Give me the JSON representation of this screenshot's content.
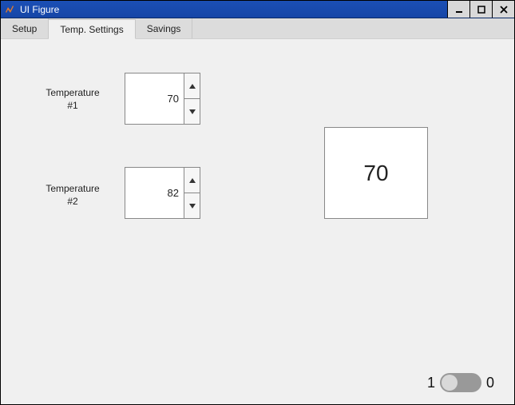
{
  "window": {
    "title": "UI Figure"
  },
  "tabs": [
    {
      "label": "Setup"
    },
    {
      "label": "Temp. Settings"
    },
    {
      "label": "Savings"
    }
  ],
  "temp1": {
    "label_line1": "Temperature",
    "label_line2": "#1",
    "value": "70"
  },
  "temp2": {
    "label_line1": "Temperature",
    "label_line2": "#2",
    "value": "82"
  },
  "display": {
    "value": "70"
  },
  "toggle": {
    "label_on": "1",
    "label_off": "0"
  }
}
